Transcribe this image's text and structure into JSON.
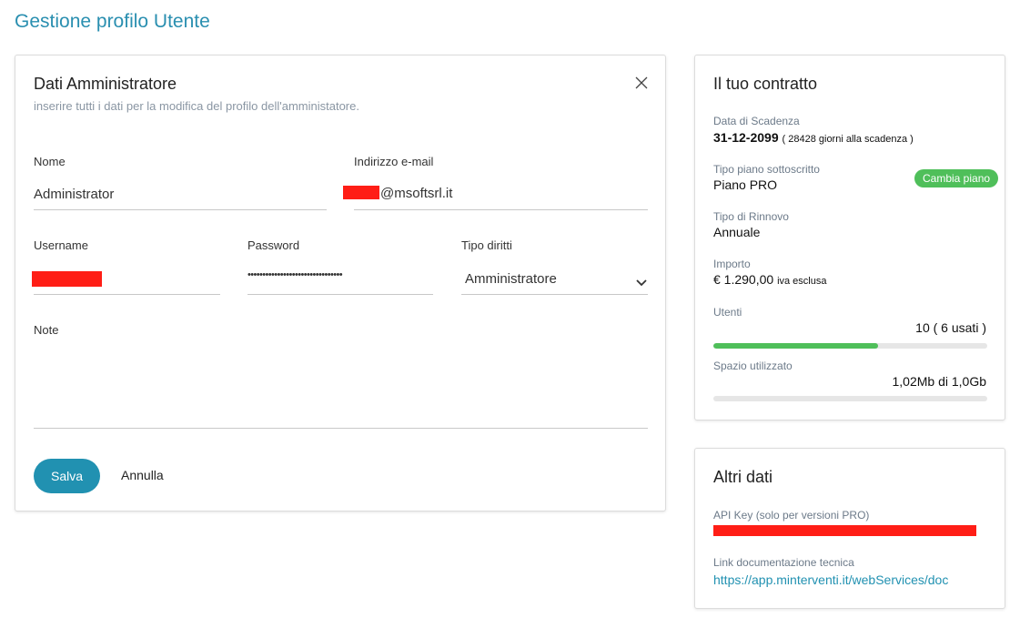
{
  "page": {
    "title": "Gestione profilo Utente"
  },
  "admin": {
    "title": "Dati Amministratore",
    "subtitle": "inserire tutti i dati per la modifica del profilo dell'amministatore.",
    "close_icon": "close-icon",
    "fields": {
      "name": {
        "label": "Nome",
        "value": "Administrator"
      },
      "email": {
        "label": "Indirizzo e-mail",
        "value_suffix": "@msoftsrl.it"
      },
      "username": {
        "label": "Username"
      },
      "password": {
        "label": "Password",
        "value": "••••••••••••••••••••••••••••••••"
      },
      "rights": {
        "label": "Tipo diritti",
        "value": "Amministratore"
      },
      "note": {
        "label": "Note"
      }
    },
    "buttons": {
      "save": "Salva",
      "cancel": "Annulla"
    },
    "colors": {
      "primary": "#2191b1",
      "redaction": "#ff1e16"
    }
  },
  "contract": {
    "title": "Il tuo contratto",
    "expiry": {
      "label": "Data di Scadenza",
      "date": "31-12-2099",
      "days_note": "( 28428 giorni alla scadenza )"
    },
    "plan": {
      "label": "Tipo piano sottoscritto",
      "value": "Piano PRO",
      "change_button": "Cambia piano"
    },
    "renewal": {
      "label": "Tipo di Rinnovo",
      "value": "Annuale"
    },
    "amount": {
      "label": "Importo",
      "value": "€ 1.290,00",
      "note": "iva esclusa"
    },
    "users": {
      "label": "Utenti",
      "value": "10 ( 6 usati )",
      "progress": 0.6
    },
    "space": {
      "label": "Spazio utilizzato",
      "value": "1,02Mb di 1,0Gb",
      "progress": 0.0
    },
    "colors": {
      "success": "#4fbf5a"
    }
  },
  "other": {
    "title": "Altri dati",
    "api_key": {
      "label": "API Key (solo per versioni PRO)"
    },
    "docs": {
      "label": "Link documentazione tecnica",
      "url": "https://app.minterventi.it/webServices/doc"
    }
  }
}
